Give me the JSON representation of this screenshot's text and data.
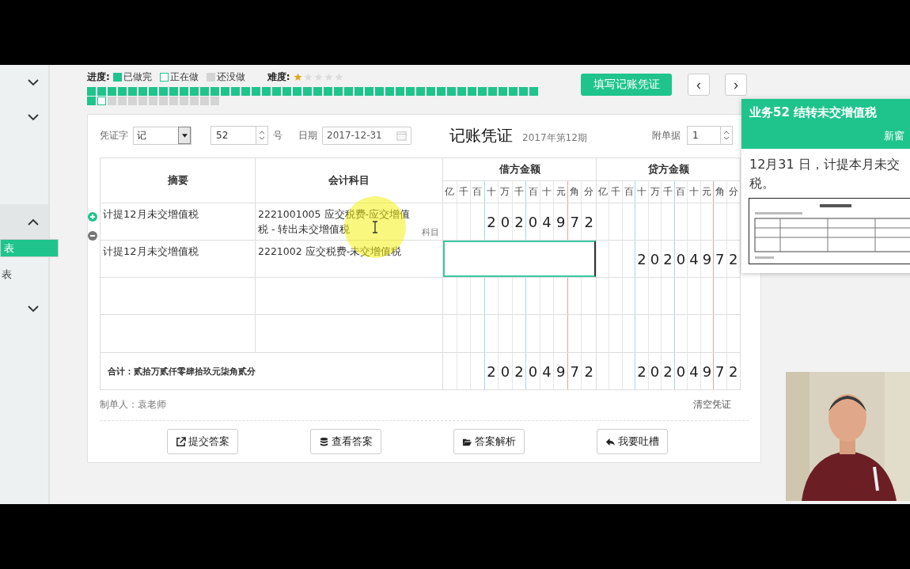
{
  "sidebar": {
    "items": [
      {
        "expanded": false
      },
      {
        "expanded": false
      },
      {
        "expanded": true,
        "children": [
          {
            "label": "表",
            "selected": true
          },
          {
            "label": "表",
            "selected": false
          }
        ]
      },
      {
        "expanded": false
      }
    ]
  },
  "progress": {
    "label": "进度:",
    "legend": [
      {
        "kind": "done",
        "label": "已做完"
      },
      {
        "kind": "current",
        "label": "正在做"
      },
      {
        "kind": "todo",
        "label": "还没做"
      }
    ],
    "items": [
      {
        "kind": "done"
      },
      {
        "kind": "done"
      },
      {
        "kind": "done"
      },
      {
        "kind": "done"
      },
      {
        "kind": "done"
      },
      {
        "kind": "done"
      },
      {
        "kind": "done"
      },
      {
        "kind": "done"
      },
      {
        "kind": "done"
      },
      {
        "kind": "done"
      },
      {
        "kind": "done"
      },
      {
        "kind": "done"
      },
      {
        "kind": "done"
      },
      {
        "kind": "done"
      },
      {
        "kind": "done"
      },
      {
        "kind": "done"
      },
      {
        "kind": "done"
      },
      {
        "kind": "done"
      },
      {
        "kind": "done"
      },
      {
        "kind": "done"
      },
      {
        "kind": "done"
      },
      {
        "kind": "done"
      },
      {
        "kind": "done"
      },
      {
        "kind": "done"
      },
      {
        "kind": "done"
      },
      {
        "kind": "done"
      },
      {
        "kind": "done"
      },
      {
        "kind": "done"
      },
      {
        "kind": "done"
      },
      {
        "kind": "done"
      },
      {
        "kind": "done"
      },
      {
        "kind": "done"
      },
      {
        "kind": "done"
      },
      {
        "kind": "done"
      },
      {
        "kind": "done"
      },
      {
        "kind": "done"
      },
      {
        "kind": "done"
      },
      {
        "kind": "done"
      },
      {
        "kind": "done"
      },
      {
        "kind": "done"
      },
      {
        "kind": "done"
      },
      {
        "kind": "done"
      },
      {
        "kind": "done"
      },
      {
        "kind": "done"
      },
      {
        "kind": "done"
      },
      {
        "kind": "current"
      },
      {
        "kind": "todo"
      },
      {
        "kind": "todo"
      },
      {
        "kind": "todo"
      },
      {
        "kind": "todo"
      },
      {
        "kind": "todo"
      },
      {
        "kind": "todo"
      },
      {
        "kind": "todo"
      },
      {
        "kind": "todo"
      },
      {
        "kind": "todo"
      },
      {
        "kind": "todo"
      },
      {
        "kind": "todo"
      }
    ]
  },
  "difficulty": {
    "label": "难度:",
    "stars": 1
  },
  "fill_button": "填写记账凭证",
  "nav": [
    "‹",
    "›"
  ],
  "voucher": {
    "word_label": "凭证字",
    "word": "记",
    "number": "52",
    "number_suffix": "号",
    "date_label": "日期",
    "date": "2017-12-31",
    "title": "记账凭证",
    "period": "2017年第12期",
    "attach_label": "附单据",
    "attach": "1",
    "headers": {
      "summary": "摘要",
      "account": "会计科目",
      "debit": "借方金额",
      "credit": "贷方金额",
      "debit_digits": [
        "亿",
        "千",
        "百",
        "十",
        "万",
        "千",
        "百",
        "十",
        "元",
        "角",
        "分"
      ],
      "credit_digits": [
        "亿",
        "千",
        "百",
        "十",
        "万",
        "千",
        "百",
        "十",
        "元",
        "角",
        "分"
      ]
    },
    "rows": [
      {
        "summary": "计提12月未交增值税",
        "account": "2221001005 应交税费-应交增值税 - 转出未交增值税",
        "tag": "科目",
        "debit": [
          "2",
          "0",
          "2",
          "0",
          "4",
          "9",
          "7",
          "2"
        ],
        "editing": false
      },
      {
        "summary": "计提12月未交增值税",
        "account": "2221002 应交税费-未交增值税",
        "credit": [
          "2",
          "0",
          "2",
          "0",
          "4",
          "9",
          "7",
          "2"
        ],
        "editing": true
      },
      {
        "editing": false
      },
      {
        "editing": false
      }
    ],
    "total": {
      "label": "合计：贰拾万贰仟零肆拾玖元柒角贰分",
      "debit": [
        "2",
        "0",
        "2",
        "0",
        "4",
        "9",
        "7",
        "2"
      ],
      "credit": [
        "2",
        "0",
        "2",
        "0",
        "4",
        "9",
        "7",
        "2"
      ]
    },
    "maker": "制单人：袁老师",
    "clear": "清空凭证",
    "actions": [
      {
        "kind": "submit",
        "label": "提交答案"
      },
      {
        "kind": "view",
        "label": "查看答案"
      },
      {
        "kind": "explain",
        "label": "答案解析"
      },
      {
        "kind": "feedback",
        "label": "我要吐槽"
      }
    ]
  },
  "task": {
    "title": "业务52 结转未交增值税",
    "link": "新窗",
    "lines": [
      "12月31 日，计提本月未交",
      "税。"
    ],
    "image": {
      "kind": "picture"
    }
  },
  "video": {
    "kind": "picture"
  }
}
